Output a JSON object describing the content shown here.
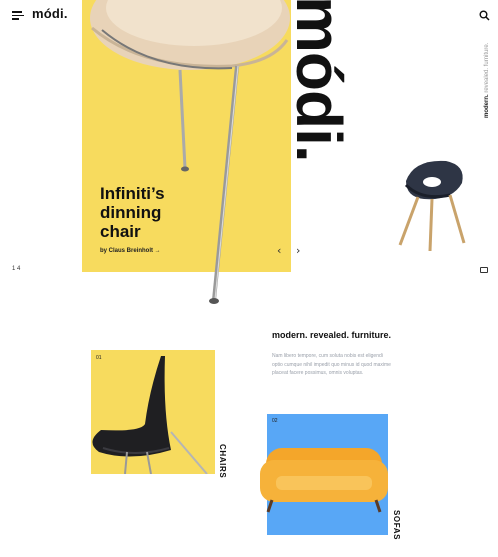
{
  "header": {
    "logo": "módi.",
    "menu_icon": "hamburger-menu-icon",
    "search_icon": "search-icon"
  },
  "hero": {
    "title": "Infiniti’s\ndinning\nchair",
    "byline": "by Claus Breinholt →",
    "prev_arrow": "‹",
    "next_arrow": "›",
    "brand_vertical": "módi.",
    "side_tagline_bold": "modern.",
    "side_tagline_rest": " revealed. furniture.",
    "slide_counter": "1   4",
    "accent_color": "#f7db5e"
  },
  "intro": {
    "heading": "modern. revealed. furniture.",
    "body": "Nam libero tempore, cum soluta nobis est eligendi optio cumque nihil impedit quo minus id quod maxime placeat facere possimus, omnis voluptas."
  },
  "categories": [
    {
      "number": "01",
      "label": "CHAIRS",
      "color": "#f7db5e"
    },
    {
      "number": "02",
      "label": "SOFAS",
      "color": "#58a7f6"
    }
  ]
}
